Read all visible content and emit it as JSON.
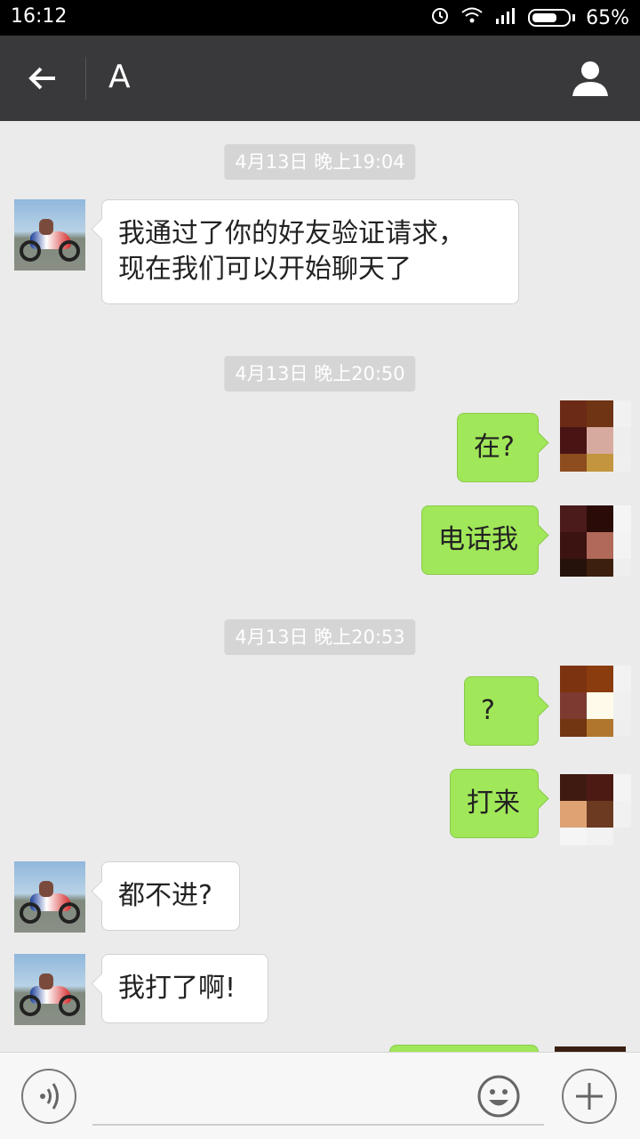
{
  "status_bar": {
    "time": "16:12",
    "battery": "65%"
  },
  "header": {
    "title": "A"
  },
  "messages": [
    {
      "type": "timestamp",
      "text": "4月13日 晚上19:04"
    },
    {
      "type": "left",
      "lines": [
        "我通过了你的好友验证请求，",
        "现在我们可以开始聊天了"
      ]
    },
    {
      "type": "timestamp",
      "text": "4月13日 晚上20:50"
    },
    {
      "type": "right",
      "text": "在?"
    },
    {
      "type": "right",
      "text": "电话我"
    },
    {
      "type": "timestamp",
      "text": "4月13日 晚上20:53"
    },
    {
      "type": "right",
      "text": "?"
    },
    {
      "type": "right",
      "text": "打来"
    },
    {
      "type": "left",
      "text": "都不进?"
    },
    {
      "type": "left",
      "text": "我打了啊!"
    }
  ],
  "colors": {
    "header_bg": "#39393b",
    "chat_bg": "#ebebeb",
    "sent_bubble": "#a0e759",
    "received_bubble": "#ffffff",
    "timestamp_bg": "#d5d5d5"
  },
  "input_bar": {
    "icons": [
      "voice-icon",
      "emoji-icon",
      "plus-icon"
    ]
  }
}
